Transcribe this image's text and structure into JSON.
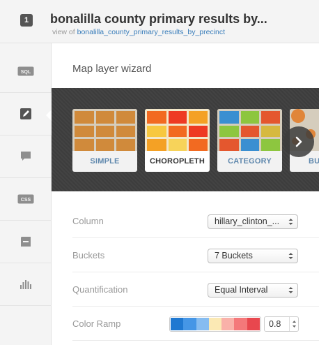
{
  "header": {
    "layer_number": "1",
    "title": "bonalilla county primary results by...",
    "view_of_prefix": "view of",
    "view_of_link": "bonalilla_county_primary_results_by_precinct"
  },
  "sidebar": {
    "items": [
      {
        "name": "sql",
        "label": "SQL"
      },
      {
        "name": "wizard",
        "label": ""
      },
      {
        "name": "infowindow",
        "label": ""
      },
      {
        "name": "css",
        "label": "CSS"
      },
      {
        "name": "legends",
        "label": ""
      },
      {
        "name": "filters",
        "label": ""
      }
    ]
  },
  "panel": {
    "title": "Map layer wizard",
    "viz_types": [
      {
        "label": "SIMPLE",
        "selected": false
      },
      {
        "label": "CHOROPLETH",
        "selected": true
      },
      {
        "label": "CATEGORY",
        "selected": false
      },
      {
        "label": "BU",
        "selected": false
      }
    ],
    "form": {
      "column_label": "Column",
      "column_value": "hillary_clinton_...",
      "buckets_label": "Buckets",
      "buckets_value": "7 Buckets",
      "quantification_label": "Quantification",
      "quantification_value": "Equal Interval",
      "color_ramp_label": "Color Ramp",
      "color_ramp_colors": [
        "#1f78d1",
        "#4596e6",
        "#86bcf0",
        "#fbe9b4",
        "#f9b1a9",
        "#f4787a",
        "#e8474e"
      ],
      "opacity_value": "0.8"
    }
  },
  "colors": {
    "link": "#397dba",
    "accent_orange": "#d08a3b"
  }
}
